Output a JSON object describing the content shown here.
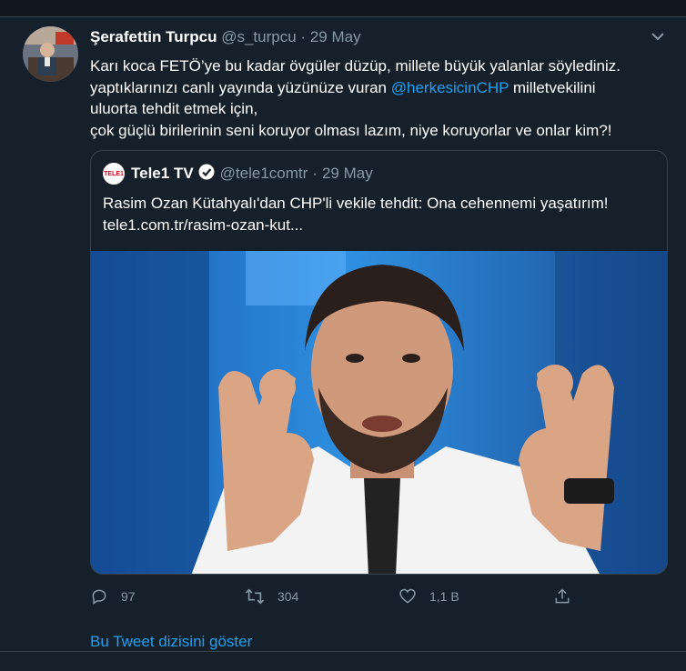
{
  "tweet": {
    "author_name": "Şerafettin Turpcu",
    "handle": "@s_turpcu",
    "separator": "·",
    "date": "29 May",
    "lines": {
      "line1": "Karı koca FETÖ’ye bu kadar övgüler düzüp, millete büyük yalanlar söylediniz.",
      "line2_pre": "yaptıklarınızı canlı yayında yüzünüze vuran ",
      "line2_mention": "@herkesicinCHP",
      "line2_post": " milletvekilini",
      "line3": "uluorta tehdit etmek için,",
      "line4": "çok güçlü birilerinin seni koruyor olması lazım, niye koruyorlar ve onlar kim?!"
    }
  },
  "quote": {
    "logo_text": "TELE1",
    "name": "Tele1 TV",
    "handle": "@tele1comtr",
    "separator": "·",
    "date": "29 May",
    "text_line1": "Rasim Ozan Kütahyalı'dan CHP'li vekile tehdit: Ona cehennemi yaşatırım!",
    "text_line2": "tele1.com.tr/rasim-ozan-kut..."
  },
  "actions": {
    "reply_count": "97",
    "retweet_count": "304",
    "like_count": "1,1 B"
  },
  "thread_link": "Bu Tweet dizisini göster",
  "icons": {
    "caret": "chevron-down-icon",
    "verified": "verified-badge-icon",
    "reply": "reply-icon",
    "retweet": "retweet-icon",
    "like": "heart-icon",
    "share": "share-icon"
  },
  "colors": {
    "background": "#15202b",
    "accent": "#1da1f2",
    "muted": "#8899a6",
    "border": "#38444d"
  }
}
